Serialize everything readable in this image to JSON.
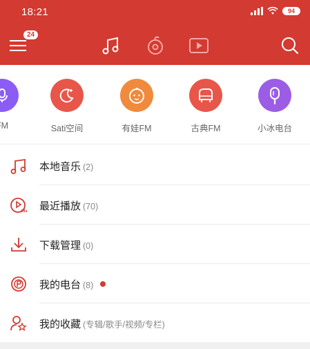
{
  "status_bar": {
    "time": "18:21",
    "battery": "94"
  },
  "toolbar": {
    "notification_badge": "24",
    "tabs": [
      "music-note-icon",
      "netease-disc-icon",
      "video-play-icon"
    ],
    "accent": "#d33a31"
  },
  "radio": [
    {
      "label": "FM",
      "color": "#8b5cf6"
    },
    {
      "label": "Sati空间",
      "color": "#e8564a"
    },
    {
      "label": "有娃FM",
      "color": "#f08a3c"
    },
    {
      "label": "古典FM",
      "color": "#e8564a"
    },
    {
      "label": "小冰电台",
      "color": "#9b5de5"
    }
  ],
  "menu": [
    {
      "label": "本地音乐",
      "count": "(2)",
      "icon": "music-note-icon"
    },
    {
      "label": "最近播放",
      "count": "(70)",
      "icon": "recent-play-icon"
    },
    {
      "label": "下载管理",
      "count": "(0)",
      "icon": "download-icon"
    },
    {
      "label": "我的电台",
      "count": "(8)",
      "icon": "radio-icon"
    },
    {
      "label": "我的收藏",
      "count": "(专辑/歌手/视频/专栏)",
      "icon": "favorite-user-icon"
    }
  ]
}
